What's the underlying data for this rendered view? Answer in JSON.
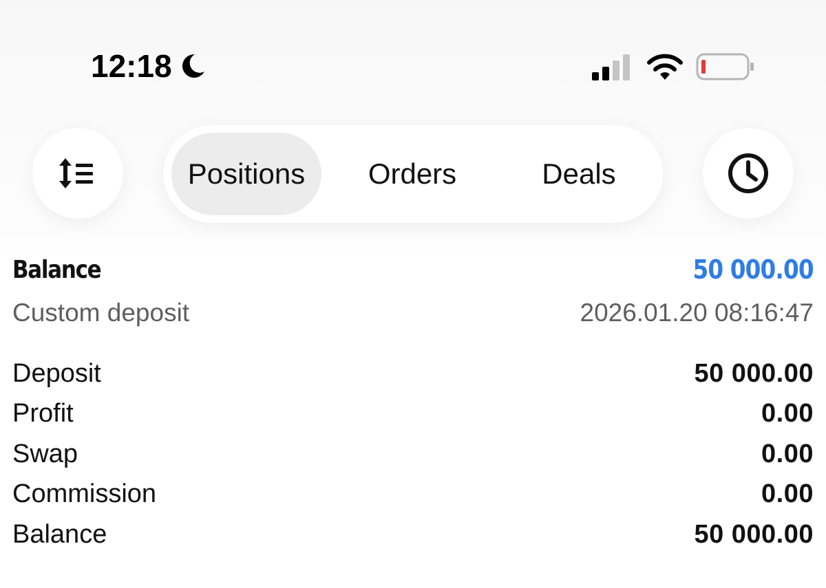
{
  "status_bar": {
    "time": "12:18",
    "icons": [
      "moon-icon",
      "signal-icon",
      "wifi-icon",
      "battery-icon"
    ]
  },
  "toolbar": {
    "sort_icon": "sort-icon",
    "history_icon": "clock-icon",
    "tabs": [
      {
        "label": "Positions",
        "selected": true
      },
      {
        "label": "Orders",
        "selected": false
      },
      {
        "label": "Deals",
        "selected": false
      }
    ]
  },
  "balance_entry": {
    "title": "Balance",
    "amount": "50 000.00",
    "comment": "Custom deposit",
    "datetime": "2026.01.20 08:16:47"
  },
  "summary": [
    {
      "label": "Deposit",
      "value": "50 000.00"
    },
    {
      "label": "Profit",
      "value": "0.00"
    },
    {
      "label": "Swap",
      "value": "0.00"
    },
    {
      "label": "Commission",
      "value": "0.00"
    },
    {
      "label": "Balance",
      "value": "50 000.00"
    }
  ],
  "colors": {
    "accent": "#2f7de3",
    "selected_tab_bg": "#ececec",
    "battery_low": "#e53935"
  }
}
